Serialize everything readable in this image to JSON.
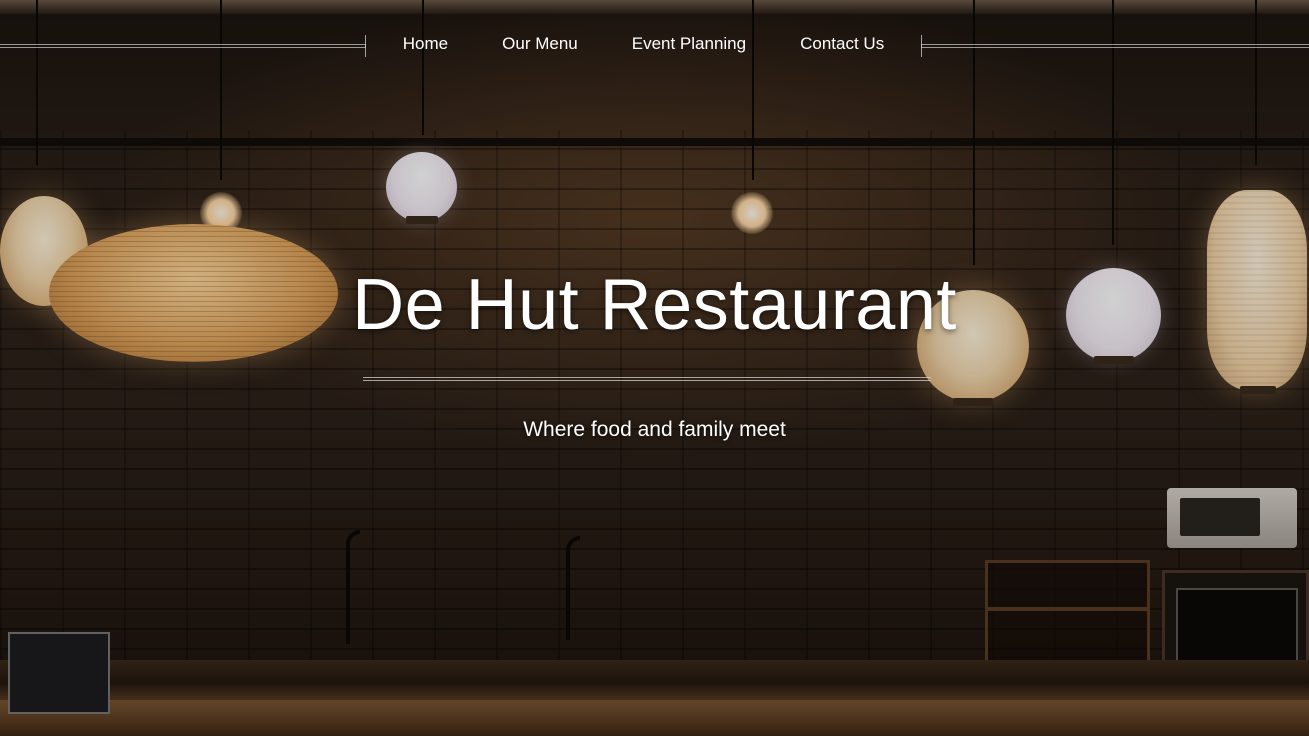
{
  "nav": {
    "items": [
      {
        "label": "Home"
      },
      {
        "label": "Our Menu"
      },
      {
        "label": "Event Planning"
      },
      {
        "label": "Contact Us"
      }
    ]
  },
  "hero": {
    "title": "De Hut Restaurant",
    "tagline": "Where food and family meet",
    "background_image": "restaurant-kitchen-with-paper-lanterns"
  },
  "colors": {
    "text": "#ffffff",
    "rule": "#d2d2d2",
    "background_dark": "#1a120c"
  }
}
